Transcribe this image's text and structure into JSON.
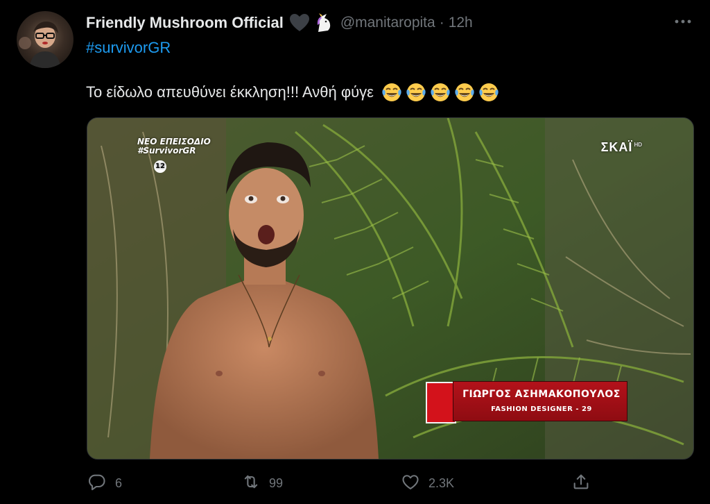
{
  "tweet": {
    "display_name": "Friendly Mushroom Official",
    "handle": "@manitaropita",
    "separator": "·",
    "time": "12h",
    "hashtag": "#survivorGR",
    "text": "Το είδωλο απευθύνει έκκληση!!! Ανθή φύγε",
    "emojis": [
      "face-with-tears-of-joy",
      "face-with-tears-of-joy",
      "face-with-tears-of-joy",
      "face-with-tears-of-joy",
      "face-with-tears-of-joy"
    ],
    "name_icons": [
      "black-heart-icon",
      "unicorn-icon"
    ]
  },
  "media": {
    "episode_badge": "12",
    "episode_line1": "ΝΕΟ ΕΠΕΙΣΟΔΙΟ",
    "episode_line2": "#SurvivorGR",
    "channel": "ΣΚΑΪ",
    "channel_hd": "HD",
    "lower_third_name": "ΓΙΩΡΓΟΣ ΑΣΗΜΑΚΟΠΟΥΛΟΣ",
    "lower_third_role": "FASHION DESIGNER - 29"
  },
  "actions": {
    "replies": "6",
    "retweets": "99",
    "likes": "2.3K"
  },
  "colors": {
    "background": "#000000",
    "text": "#e7e9ea",
    "muted": "#71767b",
    "link": "#1d9bf0",
    "accent_red": "#b3121a"
  }
}
